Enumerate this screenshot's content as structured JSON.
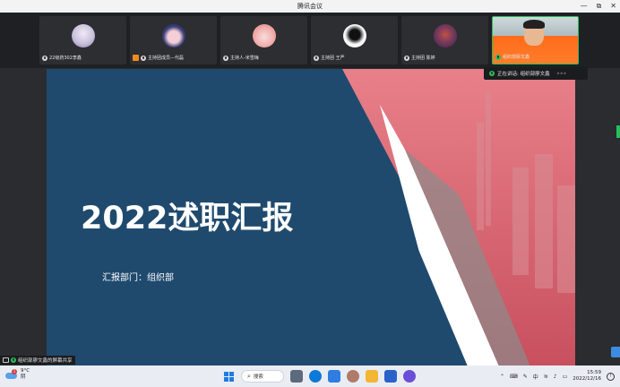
{
  "window": {
    "title": "腾讯会议",
    "controls": [
      "—",
      "⧉",
      "✕"
    ]
  },
  "participants": [
    {
      "name": "22级药302李鑫",
      "avatar_colors": [
        "#d9d4e6",
        "#8a7fb0"
      ]
    },
    {
      "name": "主持团成员—代磊",
      "avatar_colors": [
        "#3a3f78",
        "#f4cfd7"
      ]
    },
    {
      "name": "主持人-米雪梅",
      "avatar_colors": [
        "#f2b5b5",
        "#e47b7b"
      ]
    },
    {
      "name": "主持团 王严",
      "avatar_colors": [
        "#ffffff",
        "#111111"
      ]
    },
    {
      "name": "主持团 陈婷",
      "avatar_colors": [
        "#4a2a5a",
        "#c2504a"
      ]
    },
    {
      "name": "组织部廖文鑫",
      "speaking": true
    }
  ],
  "speaking_banner": {
    "label": "正在讲话: 组织部廖文鑫",
    "dots": "•••"
  },
  "slide": {
    "title": "2022述职汇报",
    "subtitle": "汇报部门：组织部",
    "colors": {
      "blue": "#1f4a6e",
      "pink": "#e0707a"
    }
  },
  "share_label": "组织部廖文鑫的屏幕共享",
  "taskbar": {
    "weather_temp": "9°C",
    "weather_desc": "阴",
    "weather_badge": "1",
    "search_label": "搜索",
    "tray_lang": "中",
    "time": "15:59",
    "date": "2022/12/16"
  }
}
